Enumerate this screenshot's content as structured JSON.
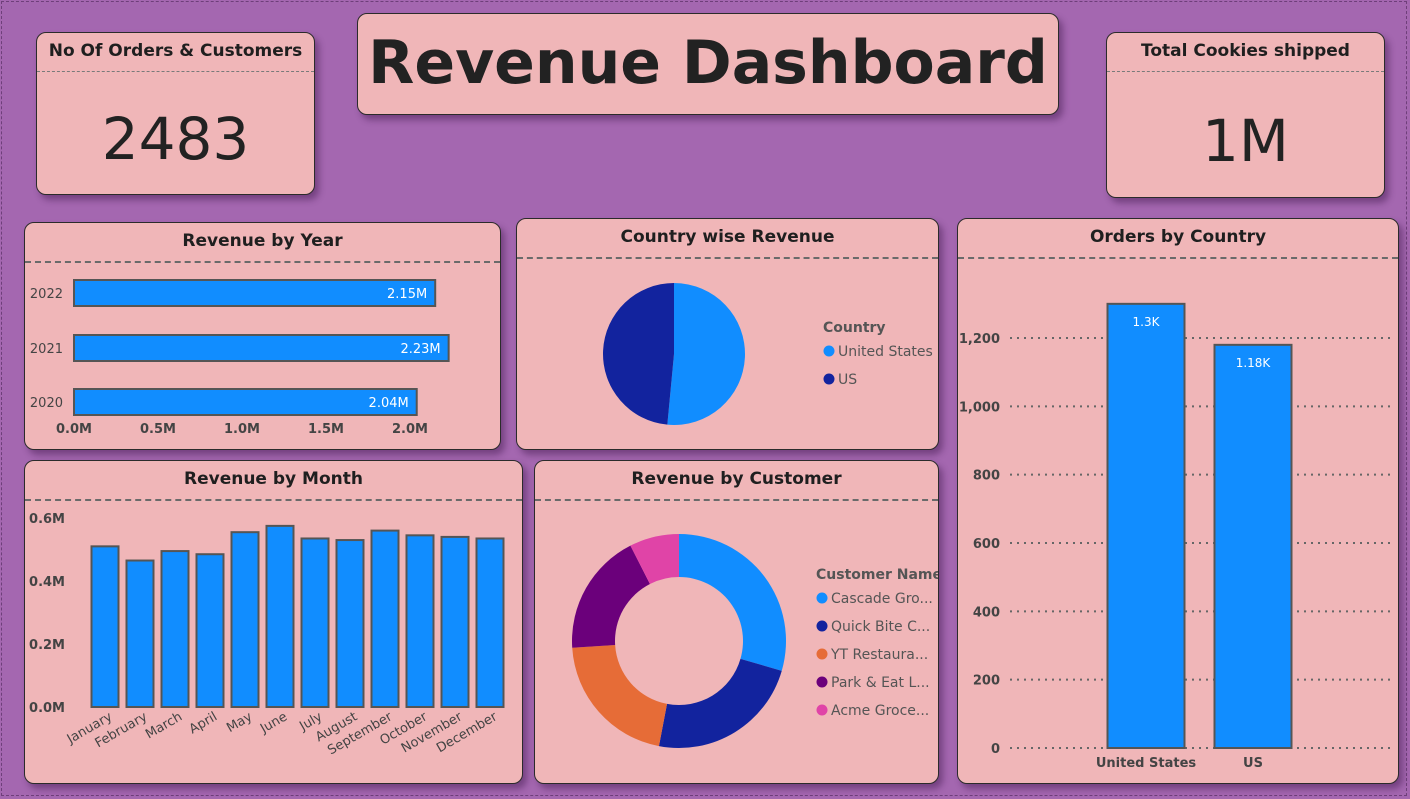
{
  "title": "Revenue Dashboard",
  "kpis": {
    "orders": {
      "label": "No Of Orders & Customers",
      "value": "2483"
    },
    "cookies": {
      "label": "Total Cookies shipped",
      "value": "1M"
    }
  },
  "colors": {
    "background": "#a467b0",
    "card": "#f0b6b8",
    "bar": "#118dff",
    "dark_blue": "#12239e",
    "orange": "#e66c37",
    "purple": "#6b007b",
    "pink": "#e044a7"
  },
  "chart_data": [
    {
      "id": "revenue_by_year",
      "type": "bar",
      "orientation": "horizontal",
      "title": "Revenue by Year",
      "categories": [
        "2022",
        "2021",
        "2020"
      ],
      "values": [
        2.15,
        2.23,
        2.04
      ],
      "data_labels": [
        "2.15M",
        "2.23M",
        "2.04M"
      ],
      "xlim": [
        0,
        2.0
      ],
      "x_ticks": [
        "0.0M",
        "0.5M",
        "1.0M",
        "1.5M",
        "2.0M"
      ],
      "x_tick_values": [
        0,
        0.5,
        1.0,
        1.5,
        2.0
      ]
    },
    {
      "id": "country_wise_revenue",
      "type": "pie",
      "title": "Country wise Revenue",
      "legend_title": "Country",
      "labels": [
        "United States",
        "US"
      ],
      "values": [
        51.5,
        48.5
      ],
      "colors": [
        "#118dff",
        "#12239e"
      ]
    },
    {
      "id": "orders_by_country",
      "type": "bar",
      "title": "Orders by Country",
      "categories": [
        "United States",
        "US"
      ],
      "values": [
        1300,
        1180
      ],
      "data_labels": [
        "1.3K",
        "1.18K"
      ],
      "ylim": [
        0,
        1200
      ],
      "y_ticks": [
        "0",
        "200",
        "400",
        "600",
        "800",
        "1,000",
        "1,200"
      ],
      "y_tick_values": [
        0,
        200,
        400,
        600,
        800,
        1000,
        1200
      ]
    },
    {
      "id": "revenue_by_month",
      "type": "bar",
      "title": "Revenue by Month",
      "categories": [
        "January",
        "February",
        "March",
        "April",
        "May",
        "June",
        "July",
        "August",
        "September",
        "October",
        "November",
        "December"
      ],
      "values": [
        0.51,
        0.465,
        0.495,
        0.485,
        0.555,
        0.575,
        0.535,
        0.53,
        0.56,
        0.545,
        0.54,
        0.535
      ],
      "ylim": [
        0,
        0.6
      ],
      "y_ticks": [
        "0.0M",
        "0.2M",
        "0.4M",
        "0.6M"
      ],
      "y_tick_values": [
        0,
        0.2,
        0.4,
        0.6
      ]
    },
    {
      "id": "revenue_by_customer",
      "type": "pie",
      "donut": true,
      "title": "Revenue by Customer",
      "legend_title": "Customer Name",
      "labels": [
        "Cascade Gro...",
        "Quick Bite C...",
        "YT Restaura...",
        "Park & Eat L...",
        "Acme Groce..."
      ],
      "values": [
        29.5,
        23.5,
        21.0,
        18.5,
        7.5
      ],
      "colors": [
        "#118dff",
        "#12239e",
        "#e66c37",
        "#6b007b",
        "#e044a7"
      ]
    }
  ]
}
